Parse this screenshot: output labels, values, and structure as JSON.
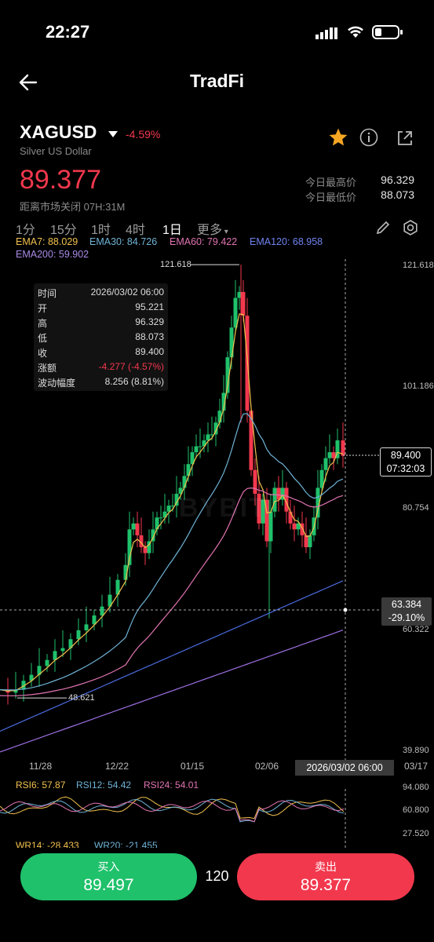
{
  "status": {
    "time": "22:27"
  },
  "header": {
    "title": "TradFi"
  },
  "instrument": {
    "symbol": "XAGUSD",
    "change_pct": "-4.59%",
    "name": "Silver US Dollar",
    "price": "89.377",
    "close_label": "距离市场关闭",
    "close_time": "07H:31M",
    "high_label": "今日最高价",
    "high_value": "96.329",
    "low_label": "今日最低价",
    "low_value": "88.073"
  },
  "timeframes": [
    "1分",
    "15分",
    "1时",
    "4时",
    "1日",
    "更多"
  ],
  "active_timeframe": "1日",
  "ema": {
    "ema7": "EMA7: 88.029",
    "ema30": "EMA30: 84.726",
    "ema60": "EMA60: 79.422",
    "ema120": "EMA120: 68.958",
    "ema200": "EMA200: 59.902"
  },
  "tooltip": {
    "time_label": "时间",
    "time_value": "2026/03/02 06:00",
    "open_label": "开",
    "open_value": "95.221",
    "high_label": "高",
    "high_value": "96.329",
    "low_label": "低",
    "low_value": "88.073",
    "close_label": "收",
    "close_value": "89.400",
    "change_label": "涨额",
    "change_value": "-4.277 (-4.57%)",
    "range_label": "波动幅度",
    "range_value": "8.256 (8.81%)"
  },
  "chart": {
    "y_ticks": [
      "121.618",
      "101.186",
      "80.754",
      "60.322",
      "39.890"
    ],
    "x_ticks": [
      "11/28",
      "12/22",
      "01/15",
      "02/06",
      "03/17"
    ],
    "max_label": "121.618",
    "min_label": "48.621",
    "last_price": "89.400",
    "countdown": "07:32:03",
    "cross_price": "63.384",
    "cross_pct": "-29.10%",
    "cross_date": "2026/03/02 06:00",
    "watermark": "BYBIT"
  },
  "indicators": {
    "rsi6": "RSI6: 57.87",
    "rsi12": "RSI12: 54.42",
    "rsi24": "RSI24: 54.01",
    "rsi_axis": [
      "94.080",
      "60.800",
      "27.520"
    ],
    "wr14": "WR14: -28.433",
    "wr20": "WR20: -21.455"
  },
  "trade": {
    "buy_label": "买入",
    "buy_price": "89.497",
    "spread": "120",
    "sell_label": "卖出",
    "sell_price": "89.377"
  },
  "colors": {
    "up": "#1fc16b",
    "down": "#f2384d",
    "ema7": "#f2c14e",
    "ema30": "#6fb3d6",
    "ema60": "#e274b2",
    "ema120": "#4a6be0",
    "ema200": "#9b6fe0"
  }
}
